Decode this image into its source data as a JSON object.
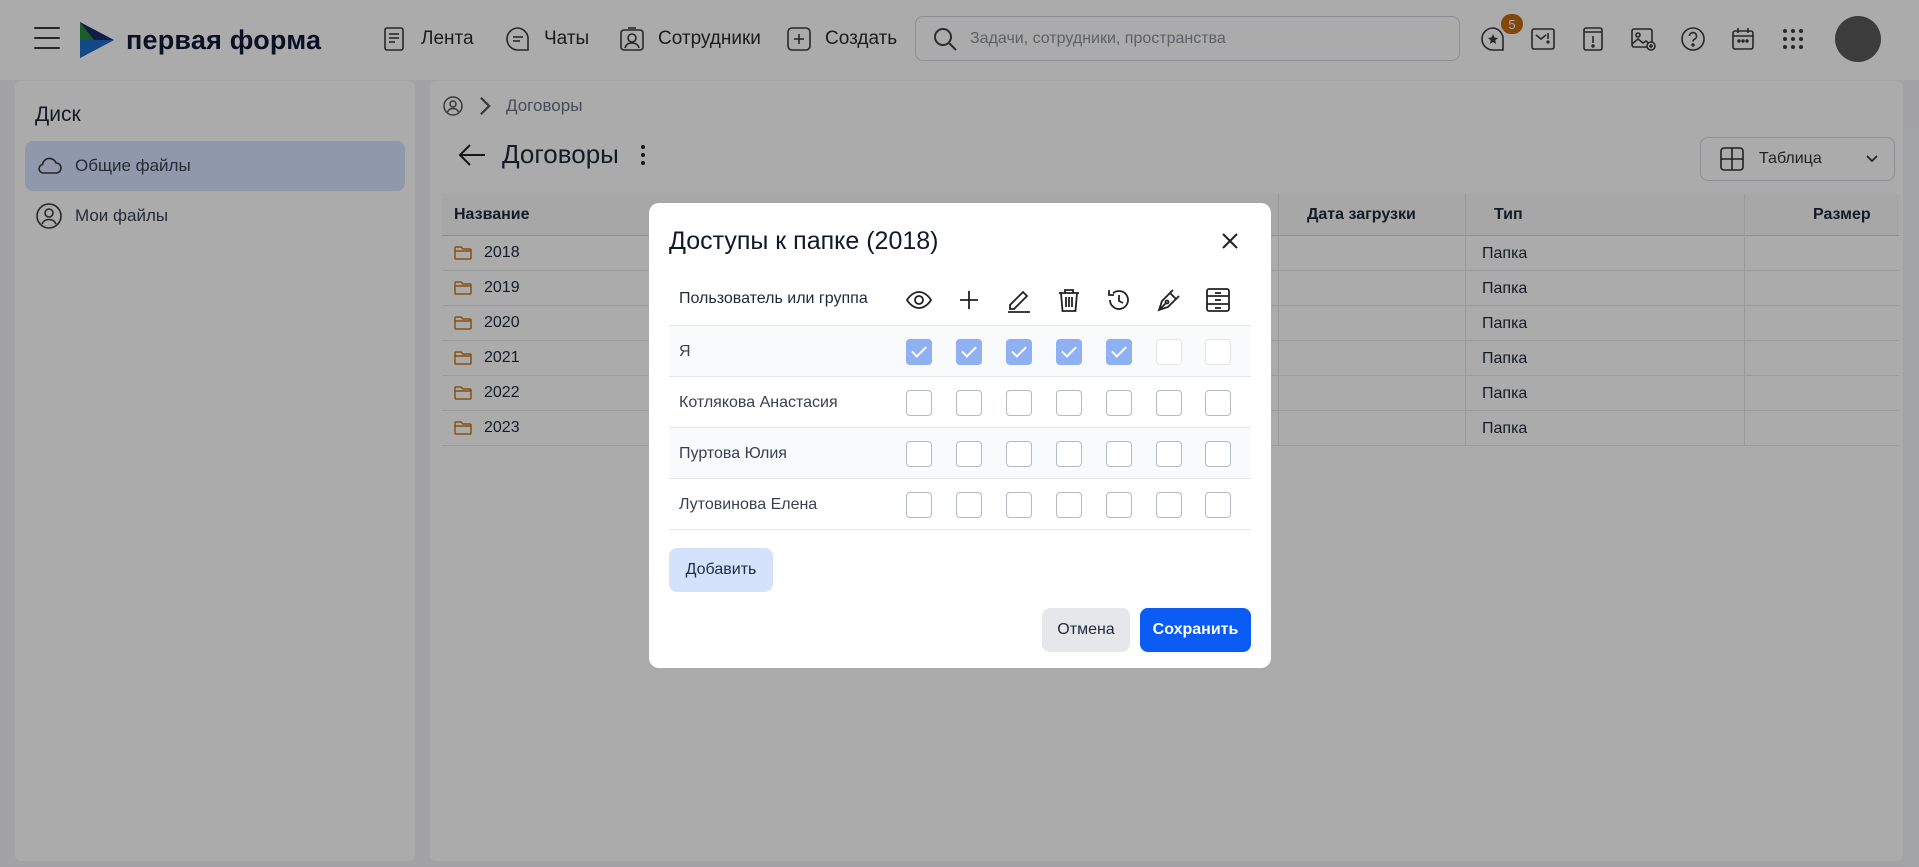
{
  "app": {
    "logo_text": "первая форма"
  },
  "nav": [
    {
      "label": "Лента",
      "icon": "feed-icon"
    },
    {
      "label": "Чаты",
      "icon": "chat-icon"
    },
    {
      "label": "Сотрудники",
      "icon": "employees-icon"
    },
    {
      "label": "Создать",
      "icon": "plus-square-icon"
    }
  ],
  "search": {
    "placeholder": "Задачи, сотрудники, пространства"
  },
  "notifications": {
    "count": "5"
  },
  "sidebar": {
    "title": "Диск",
    "items": [
      {
        "label": "Общие файлы",
        "icon": "cloud-icon",
        "active": true
      },
      {
        "label": "Мои файлы",
        "icon": "user-circle-icon",
        "active": false
      }
    ]
  },
  "breadcrumb": {
    "current": "Договоры"
  },
  "page": {
    "title": "Договоры",
    "view_label": "Таблица"
  },
  "table": {
    "columns": {
      "name": "Название",
      "upload_date": "Дата загрузки",
      "type": "Тип",
      "size": "Размер"
    },
    "rows": [
      {
        "name": "2018",
        "type": "Папка"
      },
      {
        "name": "2019",
        "type": "Папка"
      },
      {
        "name": "2020",
        "type": "Папка"
      },
      {
        "name": "2021",
        "type": "Папка"
      },
      {
        "name": "2022",
        "type": "Папка"
      },
      {
        "name": "2023",
        "type": "Папка"
      }
    ]
  },
  "dialog": {
    "title": "Доступы к папке (2018)",
    "user_column": "Пользователь или группа",
    "permission_icons": [
      "eye-icon",
      "plus-icon",
      "edit-icon",
      "trash-icon",
      "history-icon",
      "sign-pen-icon",
      "archive-icon"
    ],
    "rows": [
      {
        "user": "Я",
        "perms": [
          true,
          true,
          true,
          true,
          true,
          false,
          false
        ]
      },
      {
        "user": "Котлякова Анастасия",
        "perms": [
          false,
          false,
          false,
          false,
          false,
          false,
          false
        ]
      },
      {
        "user": "Пуртова Юлия",
        "perms": [
          false,
          false,
          false,
          false,
          false,
          false,
          false
        ]
      },
      {
        "user": "Лутовинова Елена",
        "perms": [
          false,
          false,
          false,
          false,
          false,
          false,
          false
        ]
      }
    ],
    "add_label": "Добавить",
    "cancel_label": "Отмена",
    "save_label": "Сохранить"
  }
}
